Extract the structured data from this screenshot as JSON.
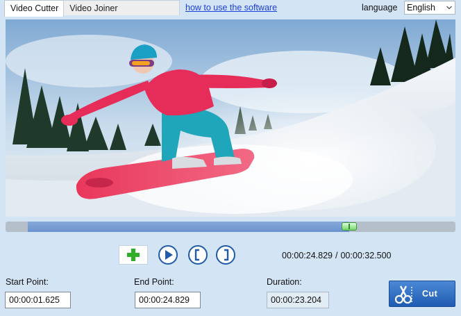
{
  "tabs": [
    {
      "label": "Video Cutter",
      "active": true
    },
    {
      "label": "Video Joiner",
      "active": false
    }
  ],
  "help_link": "how to use the software",
  "language": {
    "label": "language",
    "selected": "English"
  },
  "playback": {
    "current_time": "00:00:24.829",
    "separator": "/",
    "total_time": "00:00:32.500",
    "range_start_fraction": 0.05,
    "range_end_fraction": 0.764
  },
  "fields": {
    "start": {
      "label": "Start Point:",
      "value": "00:00:01.625"
    },
    "end": {
      "label": "End Point:",
      "value": "00:00:24.829"
    },
    "duration": {
      "label": "Duration:",
      "value": "00:00:23.204"
    }
  },
  "cut_button": {
    "label": "Cut"
  },
  "icons": {
    "add": "plus-icon",
    "play": "play-icon",
    "mark_in": "mark-in-bracket-icon",
    "mark_out": "mark-out-bracket-icon",
    "cut": "scissors-icon",
    "language_dropdown": "chevron-down-icon"
  },
  "colors": {
    "background": "#d3e4f4",
    "accent_blue": "#1f5ba8",
    "link": "#1a3fd6",
    "seek_range": "#6b93cf",
    "handle_green": "#74d66d",
    "add_green": "#2fae2a"
  }
}
